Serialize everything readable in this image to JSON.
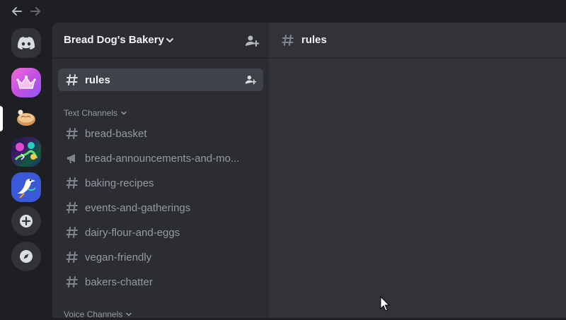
{
  "nav": {
    "back_icon": "arrow-left-icon",
    "forward_icon": "arrow-right-icon"
  },
  "servers": [
    {
      "name": "direct-messages",
      "icon": "discord-logo-icon"
    },
    {
      "name": "crown-server",
      "icon": "crown-icon"
    },
    {
      "name": "bread-dogs-bakery",
      "icon": "bread-icon",
      "selected": true
    },
    {
      "name": "art-server",
      "icon": "art-icon"
    },
    {
      "name": "bird-server",
      "icon": "bird-icon"
    },
    {
      "name": "add-server",
      "icon": "plus-icon"
    },
    {
      "name": "explore",
      "icon": "compass-icon"
    }
  ],
  "sidebar": {
    "server_name": "Bread Dog's Bakery",
    "pinned_channel": {
      "label": "rules",
      "active": true
    },
    "categories": {
      "text": "Text Channels",
      "voice": "Voice Channels"
    },
    "text_channels": [
      {
        "label": "bread-basket",
        "icon": "hash-icon"
      },
      {
        "label": "bread-announcements-and-mo...",
        "icon": "megaphone-icon"
      },
      {
        "label": "baking-recipes",
        "icon": "hash-icon"
      },
      {
        "label": "events-and-gatherings",
        "icon": "hash-icon"
      },
      {
        "label": "dairy-flour-and-eggs",
        "icon": "hash-icon"
      },
      {
        "label": "vegan-friendly",
        "icon": "hash-icon"
      },
      {
        "label": "bakers-chatter",
        "icon": "hash-icon"
      }
    ]
  },
  "main": {
    "channel_title": "rules"
  },
  "colors": {
    "rail_bg": "#1e1f22",
    "sidebar_bg": "#2b2d31",
    "main_bg": "#313338",
    "active_channel_bg": "#404249",
    "muted_text": "#949ba4",
    "bright_text": "#f2f3f5"
  }
}
